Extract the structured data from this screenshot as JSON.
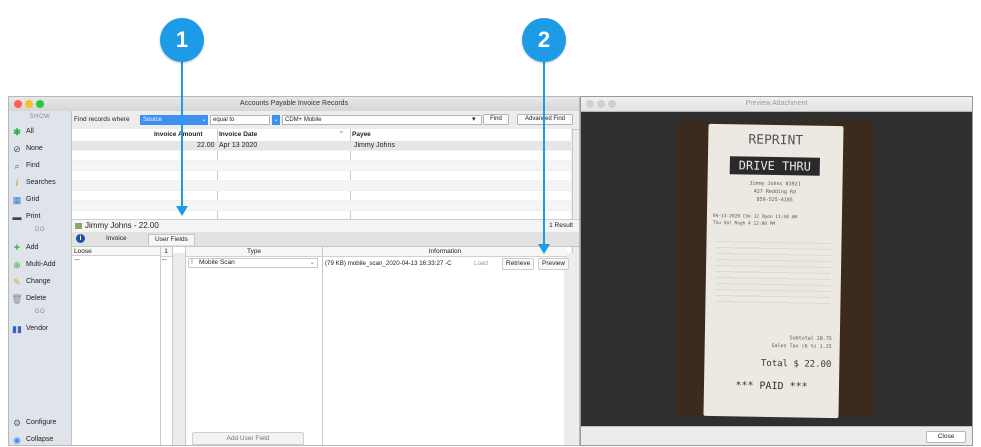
{
  "callouts": [
    "1",
    "2"
  ],
  "main_window": {
    "title": "Accounts Payable Invoice Records",
    "sidebar": {
      "show_header": "SHOW",
      "items": [
        {
          "label": "All",
          "icon": "asterisk-icon"
        },
        {
          "label": "None",
          "icon": "none-icon"
        },
        {
          "label": "Find",
          "icon": "search-icon"
        },
        {
          "label": "Searches",
          "icon": "searches-icon"
        },
        {
          "label": "Grid",
          "icon": "grid-icon"
        },
        {
          "label": "Print",
          "icon": "print-icon"
        }
      ],
      "do_header": "DO",
      "do_items": [
        {
          "label": "Add",
          "icon": "plus-icon"
        },
        {
          "label": "Multi-Add",
          "icon": "multi-add-icon"
        },
        {
          "label": "Change",
          "icon": "pencil-icon"
        },
        {
          "label": "Delete",
          "icon": "trash-icon"
        }
      ],
      "go_header": "GO",
      "go_items": [
        {
          "label": "Vendor",
          "icon": "vendor-icon"
        }
      ],
      "bottom_items": [
        {
          "label": "Configure",
          "icon": "gear-icon"
        },
        {
          "label": "Collapse",
          "icon": "collapse-icon"
        }
      ]
    },
    "find_bar": {
      "prefix": "Find records where",
      "field_value": "Source",
      "operator_value": "equal to",
      "value": "CDM+ Mobile",
      "find_button": "Find",
      "advanced_button": "Advanced Find"
    },
    "table": {
      "columns": [
        "Invoice Amount",
        "Invoice Date",
        "Payee"
      ],
      "sort_indicator": "^",
      "rows": [
        [
          "22.00",
          "Apr 13 2020",
          "Jimmy Johns"
        ]
      ]
    },
    "detail": {
      "title": "Jimmy Johns - 22.00",
      "result_count": "1 Result",
      "tabs": [
        "Invoice",
        "User Fields"
      ],
      "loose_header": "Loose",
      "loose_num": "1",
      "loose_value": "--",
      "loose_dash": "--",
      "uf_columns": [
        "Type",
        "Information"
      ],
      "uf_row": {
        "type": "Mobile Scan",
        "info": "(79 KB) mobile_scan_2020-04-13 16:33:27 -C",
        "load": "Load",
        "retrieve": "Retrieve",
        "preview": "Preview"
      },
      "add_user_field": "Add User Field"
    }
  },
  "preview_window": {
    "title": "Preview Attachment",
    "close_button": "Close",
    "receipt": {
      "header": "REPRINT",
      "banner": "DRIVE THRU",
      "lines": [
        "Jimmy Johns #3921",
        "427 Redding Rd",
        "859-525-4185"
      ],
      "order_lines": [
        "04-13-2020 Chk 12 Open 11:50 AM",
        "Thu Sal Regh 4 12:00 PM"
      ],
      "subtotal": "Subtotal 20.75",
      "tax": "Sales Tax (6 %) 1.25",
      "total_label": "Total",
      "total_value": "$ 22.00",
      "paid": "*** PAID ***"
    }
  },
  "colors": {
    "accent": "#1d9be6",
    "selection": "#3d8ff0"
  }
}
